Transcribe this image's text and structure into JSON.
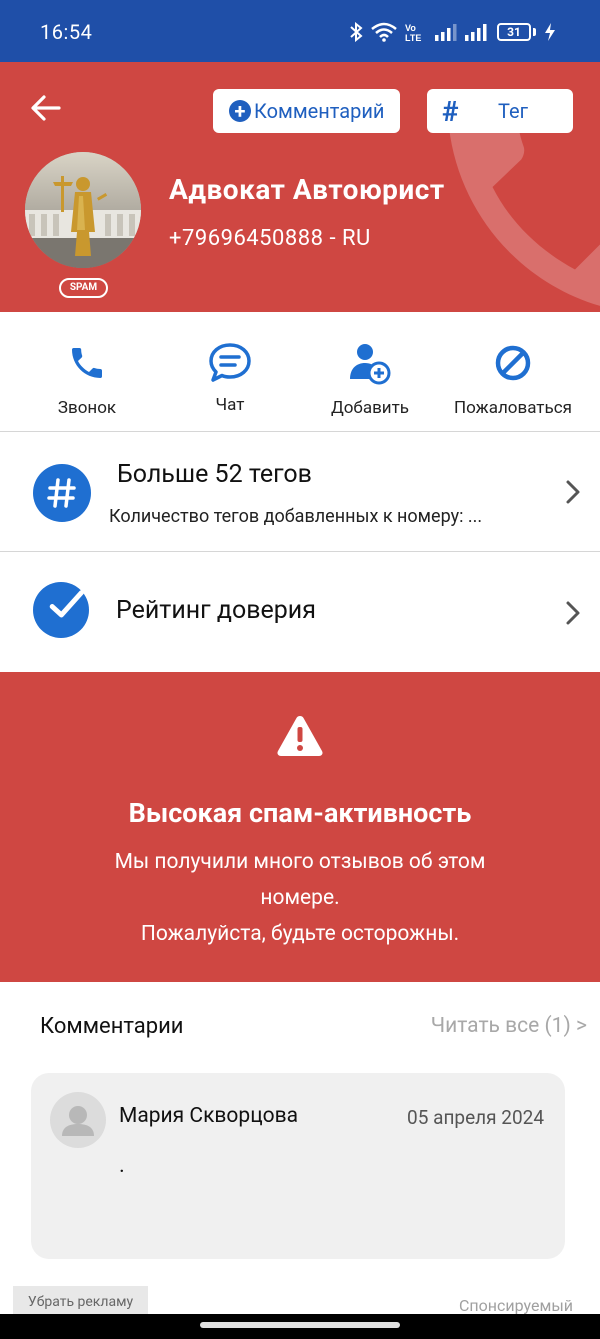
{
  "status_bar": {
    "time": "16:54",
    "battery": "31"
  },
  "header": {
    "comment_button": "Комментарий",
    "tag_button": "Тег",
    "spam_badge": "SPAM",
    "name": "Адвокат Автоюрист",
    "phone": "+79696450888 - RU",
    "colors": {
      "accent": "#cf4742",
      "status_bar": "#1f4fa8",
      "primary": "#1f5fbf"
    }
  },
  "actions": [
    {
      "label": "Звонок",
      "icon": "phone-icon"
    },
    {
      "label": "Чат",
      "icon": "chat-icon"
    },
    {
      "label": "Добавить",
      "icon": "add-contact-icon"
    },
    {
      "label": "Пожаловаться",
      "icon": "block-icon"
    }
  ],
  "tags_row": {
    "title": "Больше 52 тегов",
    "subtitle": "Количество тегов добавленных к номеру: ..."
  },
  "trust_row": {
    "title": "Рейтинг доверия"
  },
  "spam_warning": {
    "title": "Высокая спам-активность",
    "line1": "Мы получили много отзывов об этом",
    "line2": "номере.",
    "line3": "Пожалуйста, будьте осторожны."
  },
  "comments": {
    "header": "Комментарии",
    "read_all": "Читать все (1) >",
    "items": [
      {
        "author": "Мария Скворцова",
        "date": "05 апреля 2024",
        "text": "."
      }
    ]
  },
  "ads": {
    "remove_ads": "Убрать рекламу",
    "sponsored": "Спонсируемый"
  }
}
